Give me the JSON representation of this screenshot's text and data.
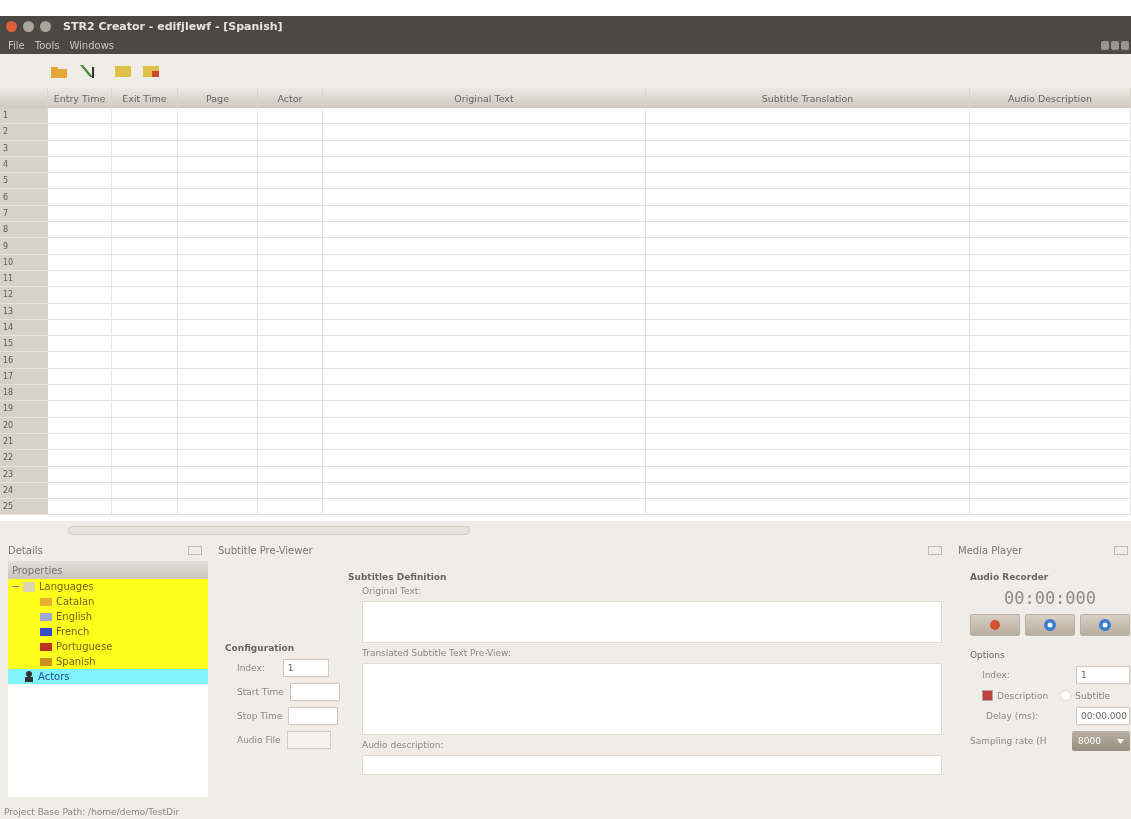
{
  "window": {
    "title": "STR2 Creator - edifjlewf - [Spanish]"
  },
  "menu": [
    "File",
    "Tools",
    "Windows"
  ],
  "table": {
    "columns": [
      "Entry Time",
      "Exit Time",
      "Page",
      "Actor",
      "Original Text",
      "Subtitle Translation",
      "Audio Description"
    ],
    "rows": [
      "1",
      "2",
      "3",
      "4",
      "5",
      "6",
      "7",
      "8",
      "9",
      "10",
      "11",
      "12",
      "13",
      "14",
      "15",
      "16",
      "17",
      "18",
      "19",
      "20",
      "21",
      "22",
      "23",
      "24",
      "25"
    ]
  },
  "details": {
    "title": "Details",
    "header": "Properties",
    "tree": [
      {
        "label": "Languages",
        "expanded": true,
        "color": "#ffff1e",
        "children": [
          {
            "label": "Catalan",
            "color": "#e8b030"
          },
          {
            "label": "English",
            "color": "#a0a8d8"
          },
          {
            "label": "French",
            "color": "#3050c0"
          },
          {
            "label": "Portuguese",
            "color": "#c03020"
          },
          {
            "label": "Spanish",
            "color": "#d09020"
          }
        ]
      },
      {
        "label": "Actors",
        "color": "#80f4fc"
      }
    ]
  },
  "previewer": {
    "title": "Subtitle Pre-Viewer",
    "configuration": {
      "heading": "Configuration",
      "index_label": "Index:",
      "index_value": "1",
      "start_label": "Start Time",
      "stop_label": "Stop Time",
      "audio_label": "Audio File"
    },
    "definition": {
      "heading": "Subtitles Definition",
      "original_label": "Original Text:",
      "translated_label": "Translated Subtitle Text Pre-View:",
      "audio_label": "Audio description:"
    }
  },
  "media_player": {
    "title": "Media Player",
    "recorder_heading": "Audio Recorder",
    "timer": "00:00:000",
    "options_heading": "Options",
    "index_label": "Index:",
    "index_value": "1",
    "description": {
      "label": "Description",
      "checked": true
    },
    "subtitle": {
      "label": "Subtitle",
      "selected": false
    },
    "delay_label": "Delay (ms):",
    "delay_value": "00:00.000",
    "sampling_label": "Sampling rate (H",
    "sampling_value": "8000"
  },
  "status_bar": "Project Base Path: /home/demo/TestDir"
}
